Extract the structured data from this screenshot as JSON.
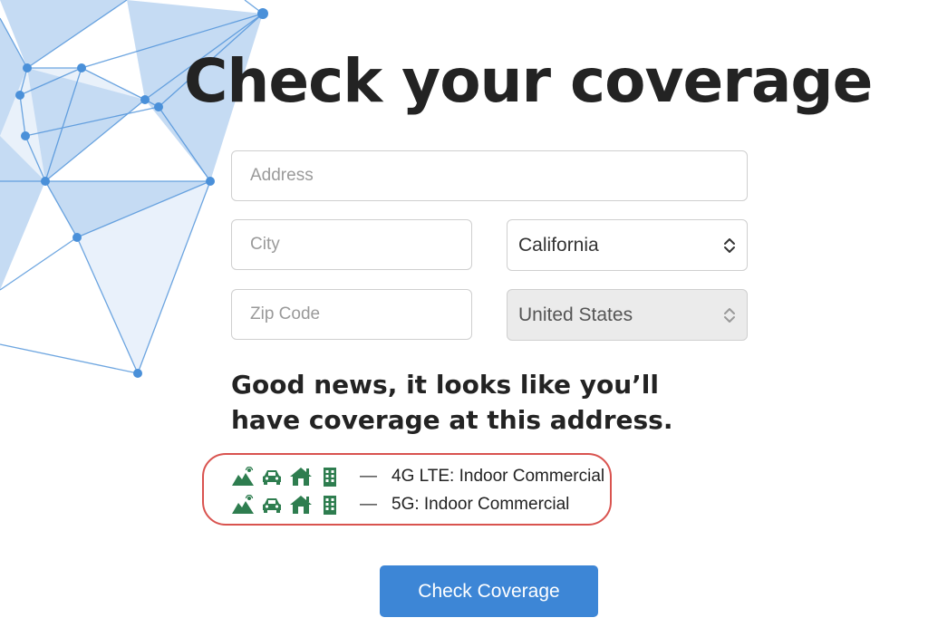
{
  "header": {
    "title": "Check your coverage"
  },
  "form": {
    "address": {
      "placeholder": "Address",
      "value": ""
    },
    "city": {
      "placeholder": "City",
      "value": ""
    },
    "state": {
      "value": "California"
    },
    "zip": {
      "placeholder": "Zip Code",
      "value": ""
    },
    "country": {
      "value": "United States"
    }
  },
  "result": {
    "heading": "Good news, it looks like you’ll have coverage at this address.",
    "rows": [
      {
        "icons": [
          "outdoor-signal-icon",
          "car-icon",
          "home-icon",
          "building-icon"
        ],
        "dash": "—",
        "text": "4G LTE: Indoor Commercial"
      },
      {
        "icons": [
          "outdoor-signal-icon",
          "car-icon",
          "home-icon",
          "building-icon"
        ],
        "dash": "—",
        "text": "5G: Indoor Commercial"
      }
    ]
  },
  "actions": {
    "check_label": "Check Coverage"
  },
  "colors": {
    "icon_green": "#2e7d4f",
    "button_blue": "#3d86d6",
    "highlight_red": "#d9534f",
    "network_blue": "#4a90d9"
  }
}
